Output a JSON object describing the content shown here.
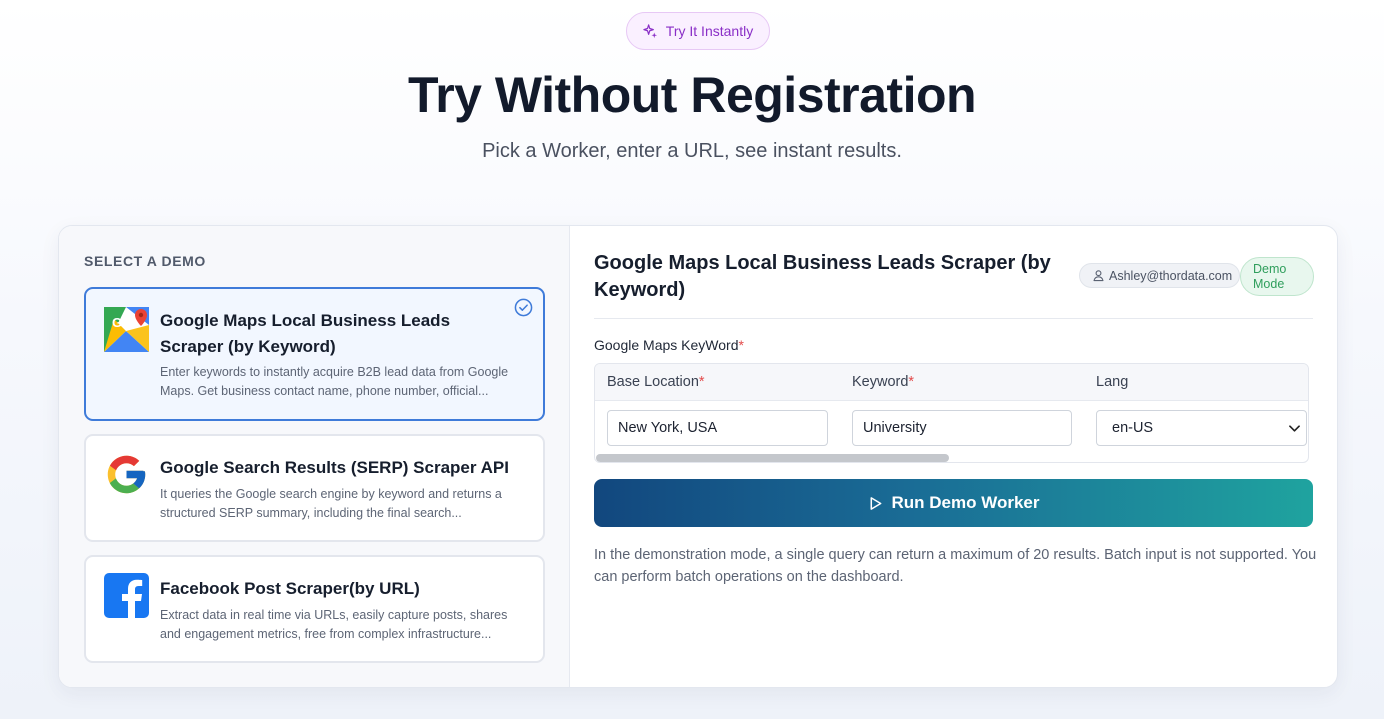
{
  "header": {
    "pill_label": "Try It Instantly",
    "title": "Try Without Registration",
    "subtitle": "Pick a Worker, enter a URL, see instant results."
  },
  "sidebar": {
    "label": "SELECT A DEMO",
    "items": [
      {
        "title": "Google Maps Local Business Leads Scraper (by Keyword)",
        "description": "Enter keywords to instantly acquire B2B lead data from Google Maps. Get business contact name, phone number, official...",
        "icon": "google-maps-icon",
        "selected": true
      },
      {
        "title": "Google Search Results (SERP) Scraper API",
        "description": "It queries the Google search engine by keyword and returns a structured SERP summary, including the final search...",
        "icon": "google-icon",
        "selected": false
      },
      {
        "title": "Facebook Post Scraper(by URL)",
        "description": "Extract data in real time via URLs, easily capture posts, shares and engagement metrics, free from complex infrastructure...",
        "icon": "facebook-icon",
        "selected": false
      }
    ]
  },
  "panel": {
    "title": "Google Maps Local Business Leads Scraper (by Keyword)",
    "user_email": "Ashley@thordata.com",
    "badge": "Demo Mode",
    "field_label": "Google Maps KeyWord",
    "required_mark": "*",
    "columns": [
      "Base Location",
      "Keyword",
      "Lang"
    ],
    "column_required": [
      true,
      true,
      false
    ],
    "row": {
      "base_location": "New York, USA",
      "keyword": "University",
      "lang": "en-US"
    },
    "run_button": "Run Demo Worker",
    "note": "In the demonstration mode, a single query can return a maximum of 20 results. Batch input is not supported. You can perform batch operations on the dashboard."
  },
  "colors": {
    "accent_blue": "#3f7bd9",
    "pill_purple": "#8a2fc7",
    "badge_green": "#2f9e5c",
    "button_start": "#12477e",
    "button_end": "#1fa39f"
  }
}
